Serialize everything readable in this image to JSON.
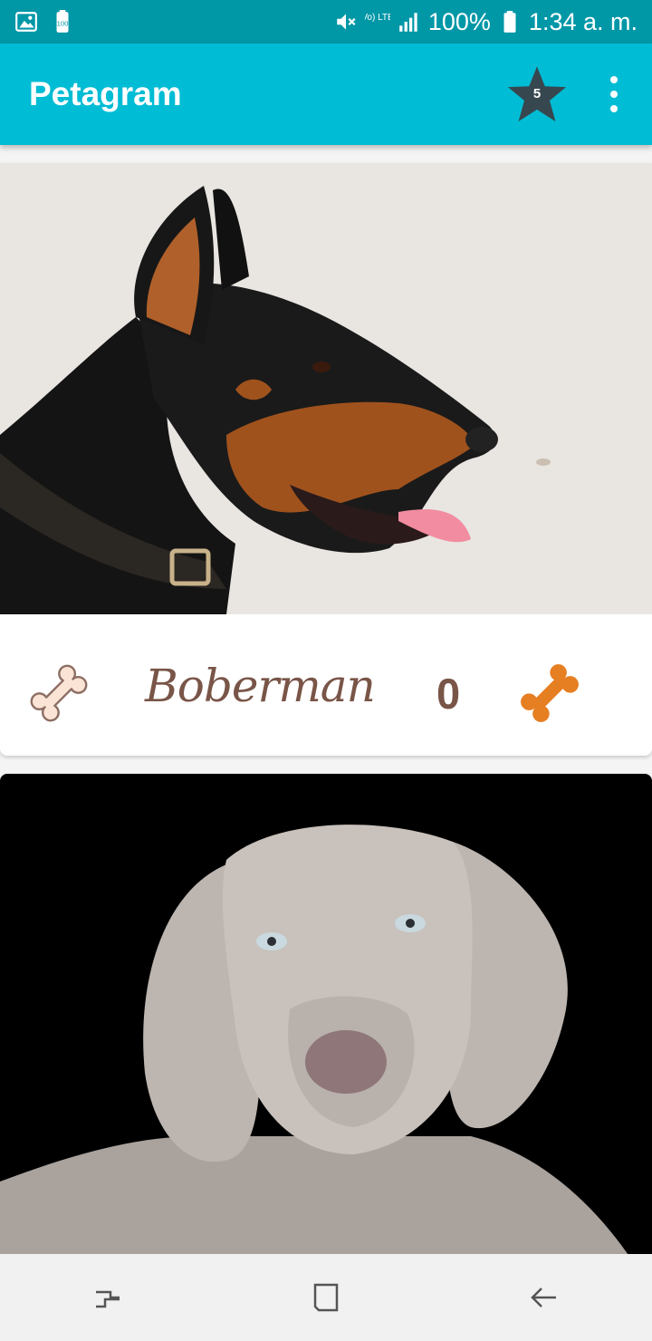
{
  "status_bar": {
    "signal_label": "Vo) LTE",
    "battery_percent": "100%",
    "time": "1:34 a. m."
  },
  "app_bar": {
    "title": "Petagram",
    "favorites_count": "5"
  },
  "pets": [
    {
      "name": "Boberman",
      "likes": "0"
    },
    {
      "name": "",
      "likes": ""
    }
  ],
  "colors": {
    "status_bar": "#0097a7",
    "app_bar": "#00bcd4",
    "star": "#37474f",
    "text_brown": "#795548",
    "bone_orange": "#e67e22",
    "bone_light": "#fbe4d5"
  },
  "icons": {
    "status_left": [
      "image-icon",
      "battery-saver-icon"
    ],
    "status_right": [
      "mute-icon",
      "signal-icon",
      "battery-icon"
    ],
    "app_bar": [
      "star-icon",
      "more-vert-icon"
    ],
    "card": [
      "bone-outline-icon",
      "bone-filled-icon"
    ],
    "nav": [
      "recent-apps-icon",
      "home-icon",
      "back-icon"
    ]
  }
}
